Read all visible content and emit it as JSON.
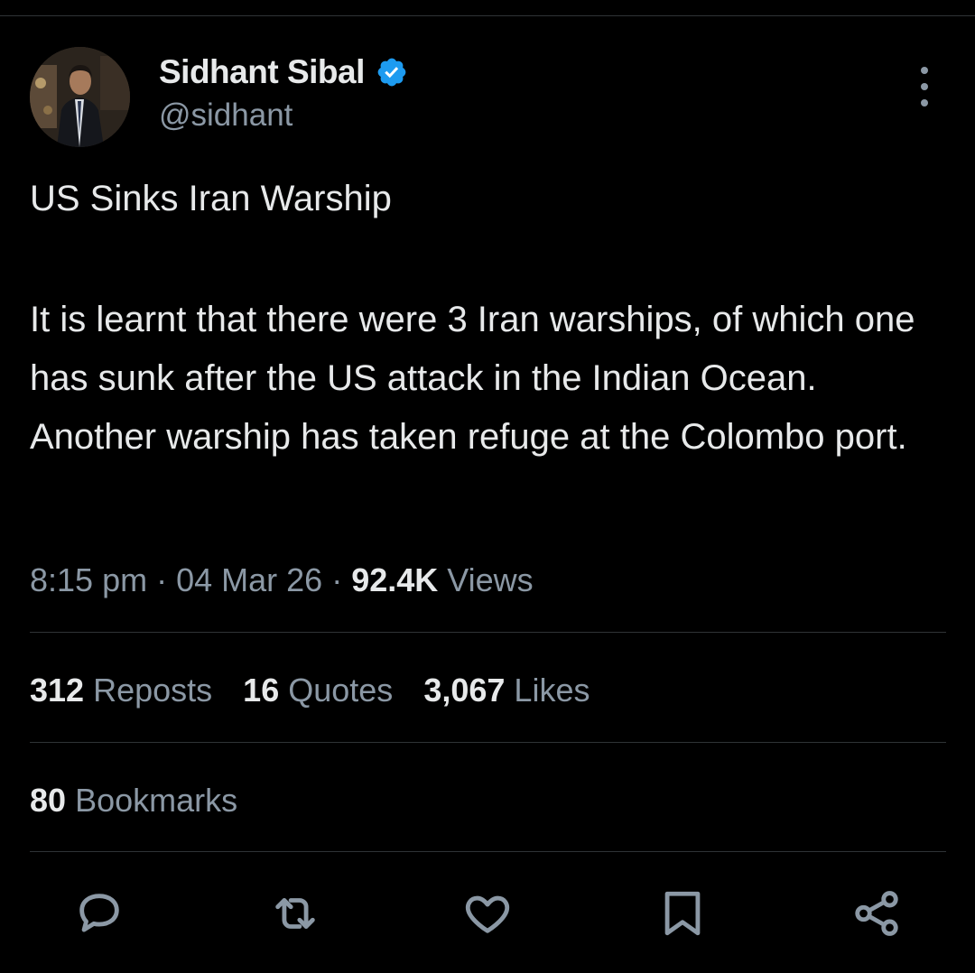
{
  "author": {
    "name": "Sidhant Sibal",
    "handle": "@sidhant",
    "verified": true,
    "verified_color": "#1d9bf0"
  },
  "tweet": {
    "title": "US Sinks Iran Warship",
    "body": "It is learnt that there were 3 Iran warships, of which one has sunk after the US attack in the Indian Ocean. Another warship has taken refuge at the Colombo port.",
    "time": "8:15 pm",
    "date": "04 Mar 26",
    "views_count": "92.4K",
    "views_label": "Views"
  },
  "stats": {
    "reposts_count": "312",
    "reposts_label": "Reposts",
    "quotes_count": "16",
    "quotes_label": "Quotes",
    "likes_count": "3,067",
    "likes_label": "Likes",
    "bookmarks_count": "80",
    "bookmarks_label": "Bookmarks"
  },
  "icons": {
    "more": "more-icon",
    "reply": "reply-icon",
    "repost": "repost-icon",
    "like": "heart-icon",
    "bookmark": "bookmark-icon",
    "share": "share-icon"
  },
  "colors": {
    "background": "#000000",
    "text_primary": "#e7e9ea",
    "text_secondary": "#8b98a5",
    "divider": "#2f3336",
    "accent": "#1d9bf0"
  }
}
